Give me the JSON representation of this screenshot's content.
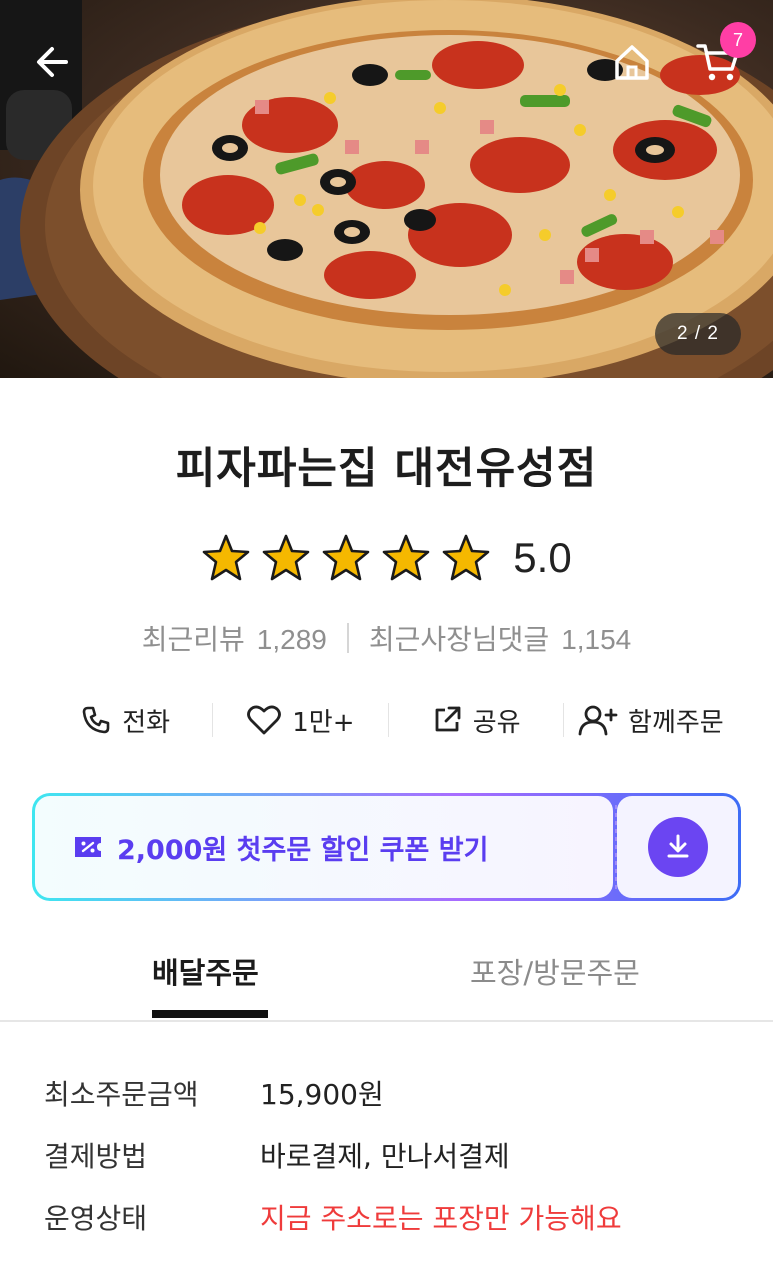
{
  "hero": {
    "pager": "2 / 2",
    "cart_count": "7"
  },
  "store": {
    "name": "피자파는집 대전유성점",
    "rating": 5.0,
    "rating_text": "5.0",
    "star_count": 5,
    "recent_reviews_label": "최근리뷰",
    "recent_reviews_count": "1,289",
    "owner_replies_label": "최근사장님댓글",
    "owner_replies_count": "1,154"
  },
  "actions": [
    {
      "label": "전화",
      "icon": "phone-icon"
    },
    {
      "label": "1만+",
      "icon": "heart-icon"
    },
    {
      "label": "공유",
      "icon": "share-icon"
    },
    {
      "label": "함께주문",
      "icon": "add-user-icon"
    }
  ],
  "coupon": {
    "text": "2,000원 첫주문 할인 쿠폰 받기",
    "icon": "coupon-icon",
    "download_icon": "download-icon"
  },
  "tabs": [
    {
      "label": "배달주문",
      "active": true
    },
    {
      "label": "포장/방문주문",
      "active": false
    }
  ],
  "info": [
    {
      "label": "최소주문금액",
      "value": "15,900원"
    },
    {
      "label": "결제방법",
      "value": "바로결제, 만나서결제"
    },
    {
      "label": "운영상태",
      "value": "지금 주소로는 포장만 가능해요"
    }
  ],
  "colors": {
    "accent": "#6b45f2",
    "badge": "#ff3ea5",
    "alert": "#ef3b3b",
    "star": "#f5b800"
  }
}
